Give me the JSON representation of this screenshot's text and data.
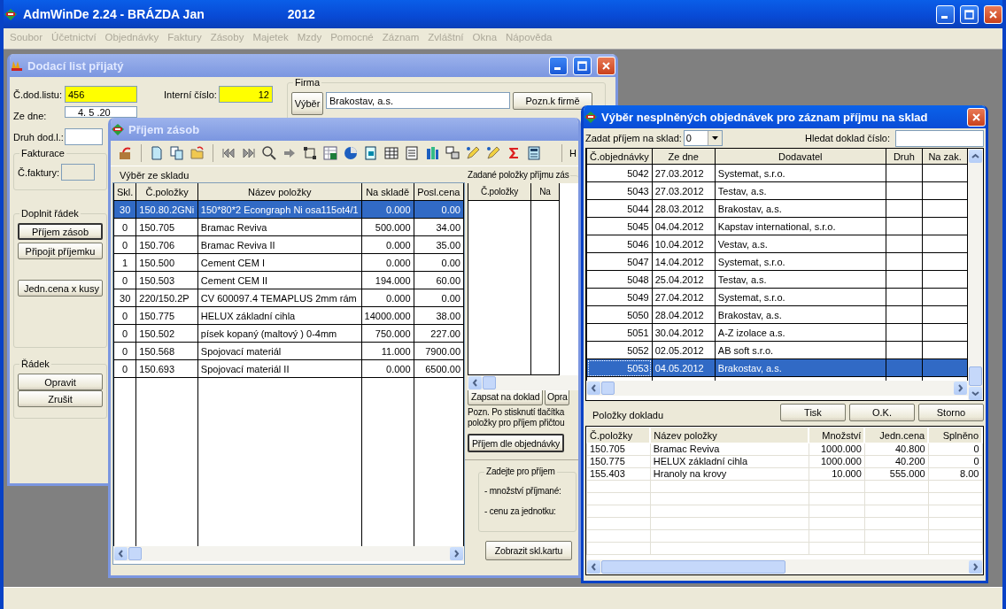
{
  "app": {
    "title": "AdmWinDe 2.24 - BRÁZDA Jan",
    "year": "2012"
  },
  "menu": [
    {
      "label": "Soubor",
      "disabled": true
    },
    {
      "label": "Účetnictví",
      "disabled": true
    },
    {
      "label": "Objednávky",
      "disabled": true
    },
    {
      "label": "Faktury",
      "disabled": true
    },
    {
      "label": "Zásoby",
      "disabled": true
    },
    {
      "label": "Majetek",
      "disabled": true
    },
    {
      "label": "Mzdy",
      "disabled": true
    },
    {
      "label": "Pomocné",
      "disabled": true
    },
    {
      "label": "Záznam",
      "disabled": true
    },
    {
      "label": "Zvláštní",
      "disabled": true
    },
    {
      "label": "Okna",
      "disabled": true
    },
    {
      "label": "Nápověda",
      "disabled": true
    }
  ],
  "delivery_window": {
    "title": "Dodací list přijatý",
    "active": false,
    "delivery_no": {
      "label": "Č.dod.listu:",
      "value": "456"
    },
    "internal_no": {
      "label": "Interní číslo:",
      "value": "12"
    },
    "date": {
      "label": "Ze dne:",
      "value": "4. 5 .20"
    },
    "doc_type": {
      "label": "Druh dod.l.:"
    },
    "firm": {
      "legend": "Firma",
      "select_button": "Výběr",
      "name": "Brakostav, a.s.",
      "note_button": "Pozn.k firmě"
    },
    "invoicing": {
      "legend": "Fakturace",
      "invoice_label": "Č.faktury:"
    },
    "add_row": {
      "legend": "Doplnit řádek",
      "buttons": [
        "Příjem zásob",
        "Připojit příjemku",
        "Jedn.cena x kusy"
      ]
    },
    "row": {
      "legend": "Řádek",
      "buttons": [
        "Opravit",
        "Zrušit"
      ]
    }
  },
  "receipt_window": {
    "title": "Příjem zásob",
    "active": false,
    "toolbar_edge_text": "H",
    "stock_label": "Výběr ze skladu",
    "columns": [
      "Skl.",
      "Č.položky",
      "Název položky",
      "Na skladě",
      "Posl.cena"
    ],
    "rows": [
      {
        "cells": [
          "30",
          "150.80.2GNi",
          "150*80*2 Econgraph Ni osa115ot4/1",
          "0.000",
          "0.00"
        ],
        "selected": true
      },
      {
        "cells": [
          "0",
          "150.705",
          "Bramac Reviva",
          "500.000",
          "34.00"
        ],
        "selected": false
      },
      {
        "cells": [
          "0",
          "150.706",
          "Bramac Reviva II",
          "0.000",
          "35.00"
        ],
        "selected": false
      },
      {
        "cells": [
          "1",
          "150.500",
          "Cement CEM I",
          "0.000",
          "0.00"
        ],
        "selected": false
      },
      {
        "cells": [
          "0",
          "150.503",
          "Cement CEM II",
          "194.000",
          "60.00"
        ],
        "selected": false
      },
      {
        "cells": [
          "30",
          "220/150.2P",
          "CV 600097.4 TEMAPLUS 2mm rám",
          "0.000",
          "0.00"
        ],
        "selected": false
      },
      {
        "cells": [
          "0",
          "150.775",
          "HELUX základní cihla",
          "14000.000",
          "38.00"
        ],
        "selected": false
      },
      {
        "cells": [
          "0",
          "150.502",
          "písek kopaný (maltový ) 0-4mm",
          "750.000",
          "227.00"
        ],
        "selected": false
      },
      {
        "cells": [
          "0",
          "150.568",
          "Spojovací materiál",
          "11.000",
          "7900.00"
        ],
        "selected": false
      },
      {
        "cells": [
          "0",
          "150.693",
          "Spojovací materiál II",
          "0.000",
          "6500.00"
        ],
        "selected": false
      }
    ],
    "entered": {
      "legend": "Zadané položky příjmu zás",
      "columns": [
        "Č.položky",
        "Na"
      ]
    },
    "buttons": [
      "Zapsat na doklad",
      "Opra"
    ],
    "note_lines": [
      "Pozn. Po stisknutí tlačítka",
      "položky pro příjem přičtou"
    ],
    "order_button": "Příjem dle objednávky",
    "enter": {
      "legend": "Zadejte pro příjem",
      "lines": [
        "- množství příjmané:",
        "- cenu za jednotku:"
      ]
    },
    "card_button": "Zobrazit skl.kartu"
  },
  "orders_window": {
    "title": "Výběr nesplněných objednávek pro záznam příjmu na sklad",
    "active": true,
    "warehouse": {
      "label": "Zadat příjem na sklad:",
      "value": "0"
    },
    "search": {
      "label": "Hledat doklad číslo:"
    },
    "columns": [
      "Č.objednávky",
      "Ze dne",
      "Dodavatel",
      "Druh",
      "Na zak."
    ],
    "rows": [
      {
        "number": "5042",
        "date": "27.03.2012",
        "supplier": "Systemat, s.r.o.",
        "selected": false
      },
      {
        "number": "5043",
        "date": "27.03.2012",
        "supplier": "Testav, a.s.",
        "selected": false
      },
      {
        "number": "5044",
        "date": "28.03.2012",
        "supplier": "Brakostav, a.s.",
        "selected": false
      },
      {
        "number": "5045",
        "date": "04.04.2012",
        "supplier": "Kapstav international, s.r.o.",
        "selected": false
      },
      {
        "number": "5046",
        "date": "10.04.2012",
        "supplier": "Vestav, a.s.",
        "selected": false
      },
      {
        "number": "5047",
        "date": "14.04.2012",
        "supplier": "Systemat, s.r.o.",
        "selected": false
      },
      {
        "number": "5048",
        "date": "25.04.2012",
        "supplier": "Testav, a.s.",
        "selected": false
      },
      {
        "number": "5049",
        "date": "27.04.2012",
        "supplier": "Systemat, s.r.o.",
        "selected": false
      },
      {
        "number": "5050",
        "date": "28.04.2012",
        "supplier": "Brakostav, a.s.",
        "selected": false
      },
      {
        "number": "5051",
        "date": "30.04.2012",
        "supplier": "A-Z izolace a.s.",
        "selected": false
      },
      {
        "number": "5052",
        "date": "02.05.2012",
        "supplier": "AB soft s.r.o.",
        "selected": false
      },
      {
        "number": "5053",
        "date": "04.05.2012",
        "supplier": "Brakostav, a.s.",
        "selected": true
      }
    ],
    "buttons": [
      "Tisk",
      "O.K.",
      "Storno"
    ],
    "items_label": "Položky dokladu",
    "item_columns": [
      "Č.položky",
      "Název položky",
      "Množství",
      "Jedn.cena",
      "Splněno"
    ],
    "items": [
      [
        "150.705",
        "Bramac Reviva",
        "1000.000",
        "40.800",
        "0"
      ],
      [
        "150.775",
        "HELUX základní cihla",
        "1000.000",
        "40.200",
        "0"
      ],
      [
        "155.403",
        "Hranoly na krovy",
        "10.000",
        "555.000",
        "8.00"
      ]
    ]
  }
}
